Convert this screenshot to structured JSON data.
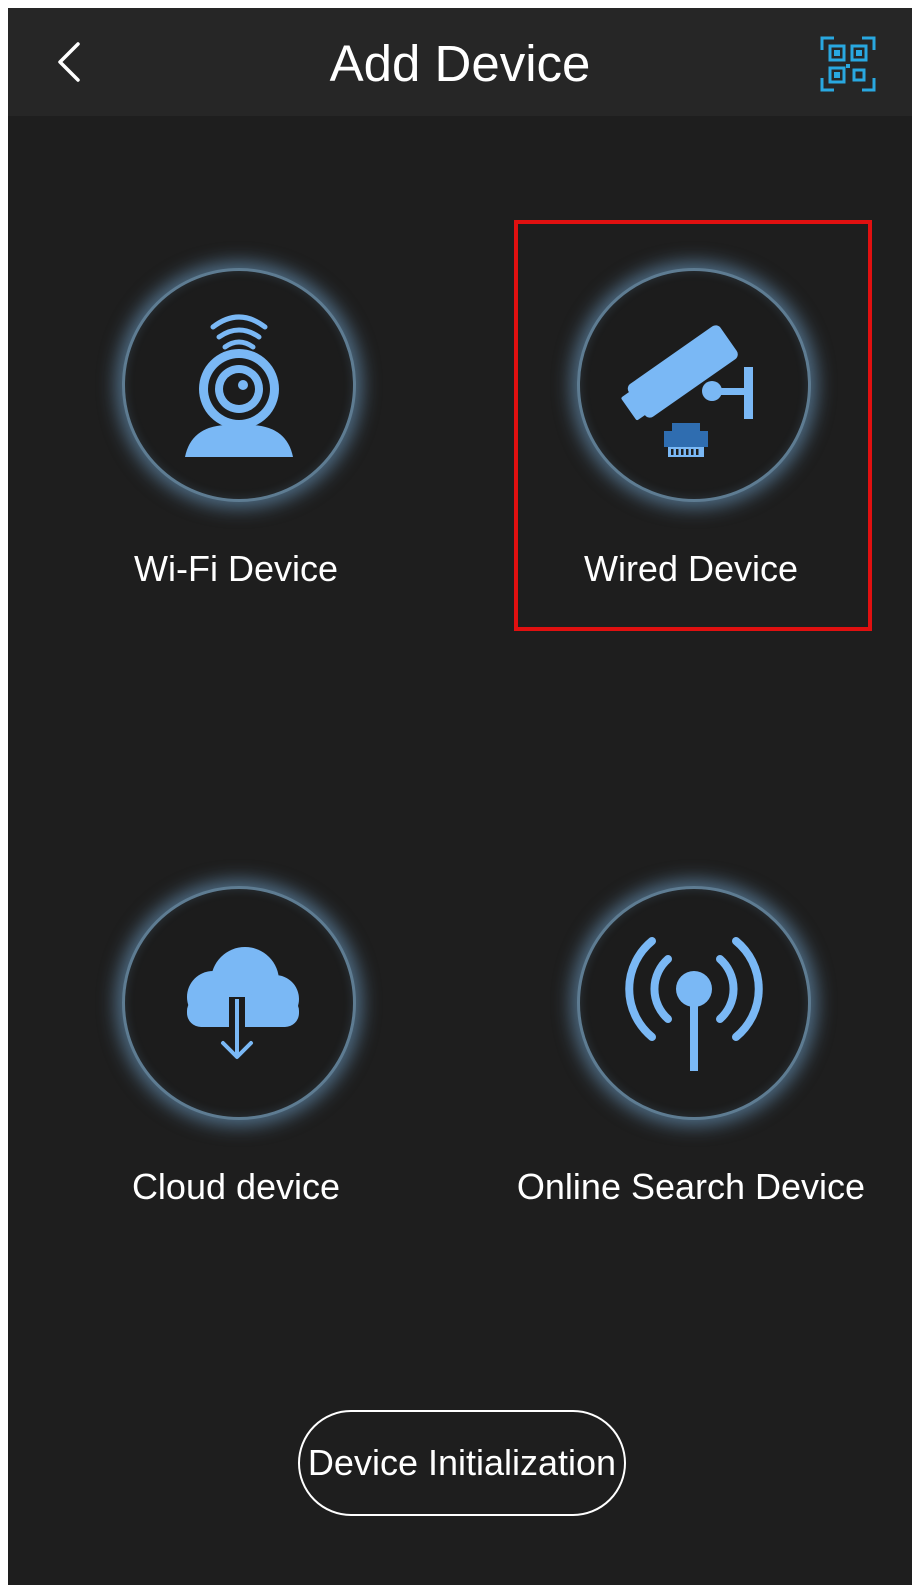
{
  "header": {
    "title": "Add Device",
    "back_icon": "chevron-left-icon",
    "qr_icon": "qr-scan-icon"
  },
  "tiles": [
    {
      "label": "Wi-Fi Device",
      "icon": "wifi-camera-icon"
    },
    {
      "label": "Wired Device",
      "icon": "wired-camera-icon",
      "highlighted": true
    },
    {
      "label": "Cloud device",
      "icon": "cloud-download-icon"
    },
    {
      "label": "Online Search Device",
      "icon": "broadcast-signal-icon"
    }
  ],
  "footer": {
    "init_button_label": "Device Initialization"
  },
  "colors": {
    "background": "#1e1e1e",
    "header": "#262626",
    "icon_blue": "#7ab8f5",
    "accent_qr": "#29a8e0",
    "highlight": "#e01010"
  }
}
